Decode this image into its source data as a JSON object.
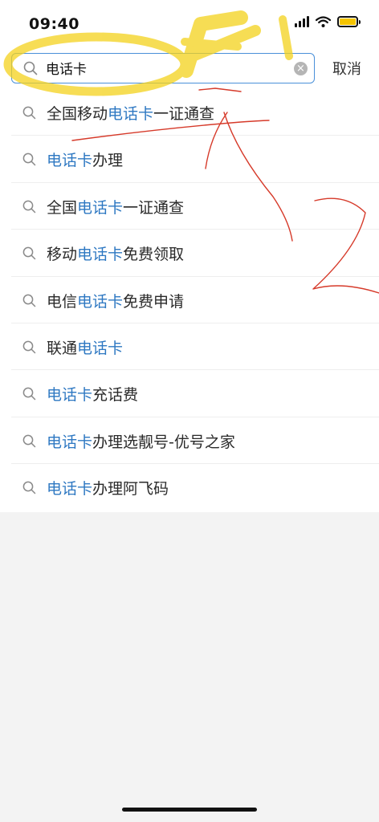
{
  "status_bar": {
    "time": "09:40"
  },
  "search": {
    "value": "电话卡",
    "cancel_label": "取消"
  },
  "suggestions": [
    {
      "before": "全国移动",
      "highlight": "电话卡",
      "after": "一证通查"
    },
    {
      "before": "",
      "highlight": "电话卡",
      "after": "办理"
    },
    {
      "before": "全国",
      "highlight": "电话卡",
      "after": "一证通查"
    },
    {
      "before": "移动",
      "highlight": "电话卡",
      "after": "免费领取"
    },
    {
      "before": "电信",
      "highlight": "电话卡",
      "after": "免费申请"
    },
    {
      "before": "联通",
      "highlight": "电话卡",
      "after": ""
    },
    {
      "before": "",
      "highlight": "电话卡",
      "after": "充话费"
    },
    {
      "before": "",
      "highlight": "电话卡",
      "after": "办理选靓号-优号之家"
    },
    {
      "before": "",
      "highlight": "电话卡",
      "after": "办理阿飞码"
    }
  ],
  "colors": {
    "highlight": "#2e78c2",
    "search_border": "#4a90d9",
    "annotation_yellow": "#f4d21c",
    "annotation_red": "#d63a2a",
    "background": "#f3f3f3"
  },
  "icons": [
    "search-icon",
    "clear-icon",
    "signal-icon",
    "wifi-icon",
    "battery-icon"
  ]
}
